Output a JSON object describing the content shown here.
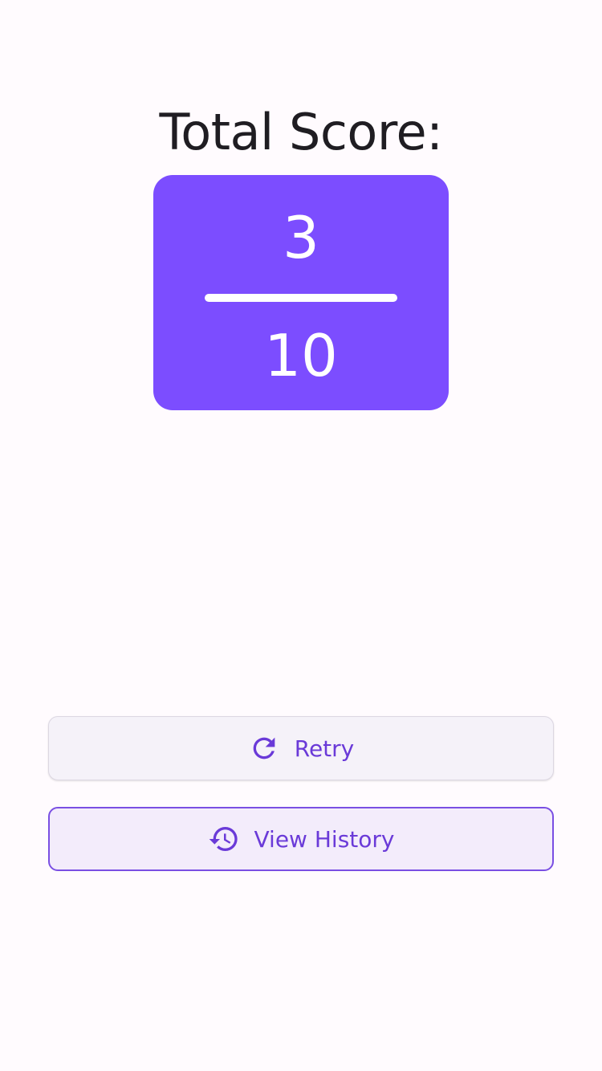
{
  "title": "Total Score:",
  "score": {
    "value": "3",
    "total": "10"
  },
  "buttons": {
    "retry": {
      "label": "Retry",
      "icon": "refresh-icon"
    },
    "history": {
      "label": "View History",
      "icon": "history-icon"
    }
  },
  "colors": {
    "accent": "#7c4dff",
    "button_text": "#6a3ad8",
    "background": "#fffbfe"
  }
}
